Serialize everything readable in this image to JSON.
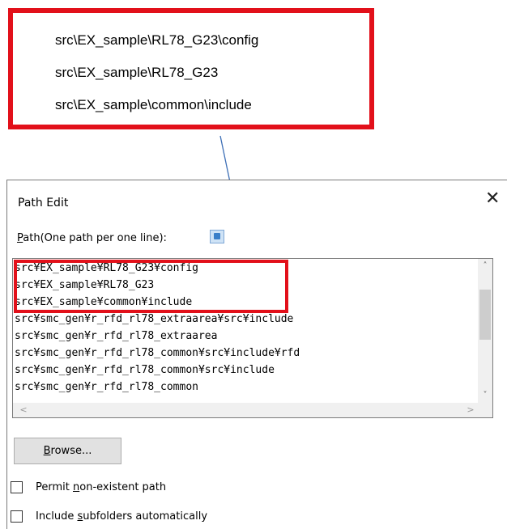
{
  "callout": {
    "lines": [
      "src\\EX_sample\\RL78_G23\\config",
      "src\\EX_sample\\RL78_G23",
      "src\\EX_sample\\common\\include"
    ],
    "border_color": "#e2101a"
  },
  "dialog": {
    "title": "Path Edit",
    "close_glyph": "✕",
    "path_label_mnemonic": "P",
    "path_label_rest": "ath(One path per one line):",
    "paths": [
      "src¥EX_sample¥RL78_G23¥config",
      "src¥EX_sample¥RL78_G23",
      "src¥EX_sample¥common¥include",
      "src¥smc_gen¥r_rfd_rl78_extraarea¥src¥include",
      "src¥smc_gen¥r_rfd_rl78_extraarea",
      "src¥smc_gen¥r_rfd_rl78_common¥src¥include¥rfd",
      "src¥smc_gen¥r_rfd_rl78_common¥src¥include",
      "src¥smc_gen¥r_rfd_rl78_common"
    ],
    "scroll": {
      "up": "˄",
      "down": "˅",
      "left": "<",
      "right": ">"
    },
    "browse_mnemonic": "B",
    "browse_rest": "rowse...",
    "checkboxes": [
      {
        "prefix": "Permit ",
        "mnemonic": "n",
        "rest": "on-existent path",
        "checked": false
      },
      {
        "prefix": "Include ",
        "mnemonic": "s",
        "rest": "ubfolders automatically",
        "checked": false
      }
    ],
    "icons": [
      "info-icon"
    ]
  }
}
